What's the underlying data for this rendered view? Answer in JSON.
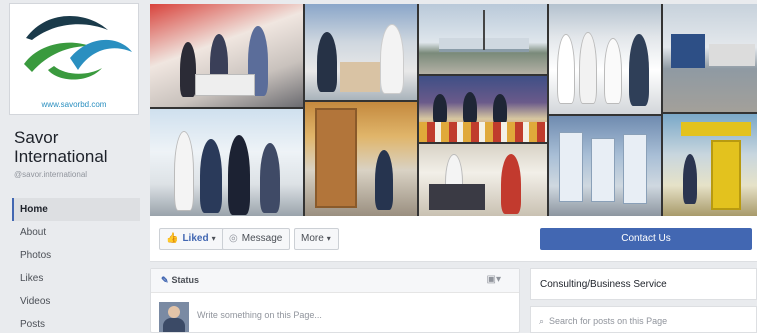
{
  "page": {
    "name": "Savor International",
    "handle": "@savor.international",
    "logo_url": "www.savorbd.com"
  },
  "nav": {
    "items": [
      {
        "label": "Home",
        "active": true
      },
      {
        "label": "About",
        "active": false
      },
      {
        "label": "Photos",
        "active": false
      },
      {
        "label": "Likes",
        "active": false
      },
      {
        "label": "Videos",
        "active": false
      },
      {
        "label": "Posts",
        "active": false
      }
    ]
  },
  "actions": {
    "liked_label": "Liked",
    "liked_icon": "thumbs-up-icon",
    "message_label": "Message",
    "message_icon": "chat-bubble-icon",
    "more_label": "More",
    "contact_label": "Contact Us"
  },
  "composer": {
    "tab_label": "Status",
    "placeholder": "Write something on this Page..."
  },
  "side": {
    "category": "Consulting/Business Service",
    "search_placeholder": "Search for posts on this Page"
  },
  "colors": {
    "facebook_blue": "#4267b2",
    "background": "#e9ebee",
    "logo_green": "#3a9a3e",
    "logo_blue": "#2a8fc0",
    "logo_dark": "#1a3a4a"
  }
}
